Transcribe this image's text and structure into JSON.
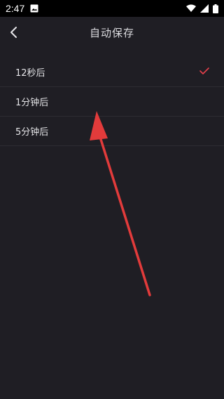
{
  "status_bar": {
    "time": "2:47",
    "icons": [
      "image-icon",
      "wifi-icon",
      "signal-icon",
      "battery-icon"
    ]
  },
  "nav": {
    "title": "自动保存",
    "back_icon": "chevron-left-icon"
  },
  "options": [
    {
      "label": "12秒后",
      "selected": true
    },
    {
      "label": "1分钟后",
      "selected": false
    },
    {
      "label": "5分钟后",
      "selected": false
    }
  ],
  "colors": {
    "background": "#1f1e24",
    "accent_check": "#e5404b",
    "annotation_arrow": "#e23b3b"
  }
}
